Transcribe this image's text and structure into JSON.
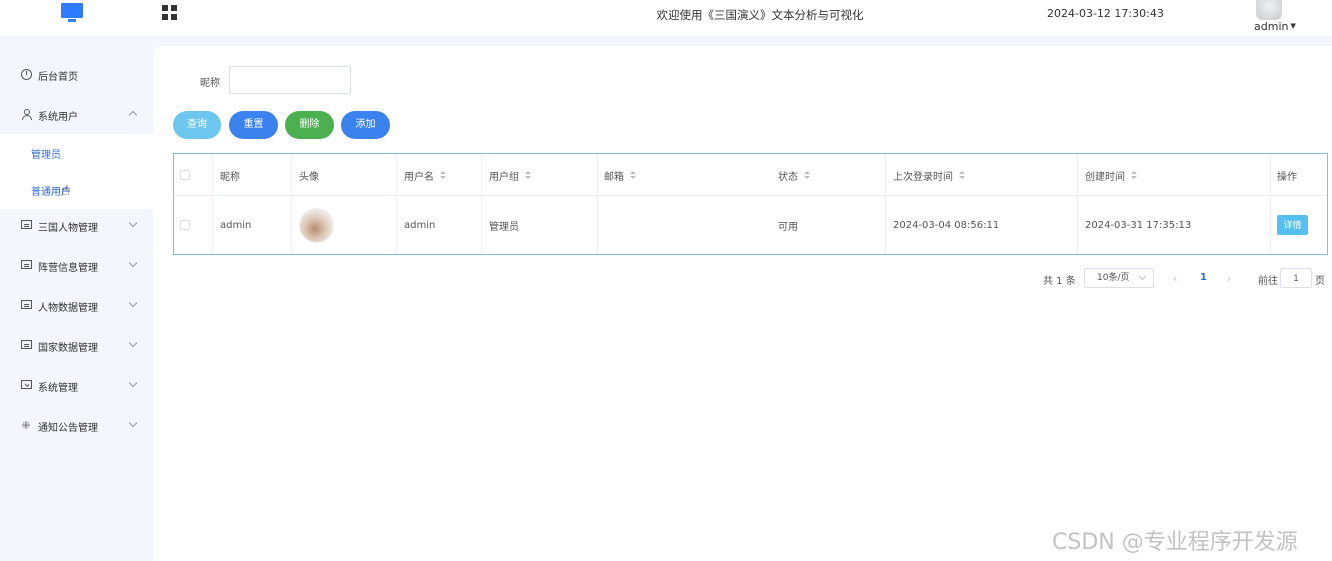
{
  "header": {
    "site_title": "欢迎使用《三国演义》文本分析与可视化",
    "datetime": "2024-03-12 17:30:43",
    "username": "admin"
  },
  "sidebar": {
    "items": [
      {
        "label": "后台首页",
        "icon": "dashboard-icon"
      },
      {
        "label": "系统用户",
        "icon": "user-icon",
        "expanded": true
      },
      {
        "label": "三国人物管理",
        "icon": "card-icon"
      },
      {
        "label": "阵营信息管理",
        "icon": "card-icon"
      },
      {
        "label": "人物数据管理",
        "icon": "card-icon"
      },
      {
        "label": "国家数据管理",
        "icon": "card-icon"
      },
      {
        "label": "系统管理",
        "icon": "folder-check-icon"
      },
      {
        "label": "通知公告管理",
        "icon": "burst-icon"
      }
    ],
    "submenu": [
      {
        "label": "管理员"
      },
      {
        "label": "普通用户"
      }
    ]
  },
  "search": {
    "label": "昵称",
    "value": "",
    "placeholder": ""
  },
  "toolbar": {
    "query_label": "查询",
    "reset_label": "重置",
    "delete_label": "删除",
    "add_label": "添加"
  },
  "table": {
    "headers": [
      "昵称",
      "头像",
      "用户名",
      "用户组",
      "邮箱",
      "状态",
      "上次登录时间",
      "创建时间",
      "操作"
    ],
    "rows": [
      {
        "nickname": "admin",
        "username": "admin",
        "group": "管理员",
        "email": "",
        "status": "可用",
        "last_login": "2024-03-04 08:56:11",
        "created": "2024-03-31 17:35:13",
        "action": "详情"
      }
    ]
  },
  "pagination": {
    "total": "共 1 条",
    "page_size": "10条/页",
    "current": "1",
    "goto_label": "前往",
    "goto_value": "1",
    "page_suffix": "页"
  },
  "watermark": "CSDN @专业程序开发源"
}
